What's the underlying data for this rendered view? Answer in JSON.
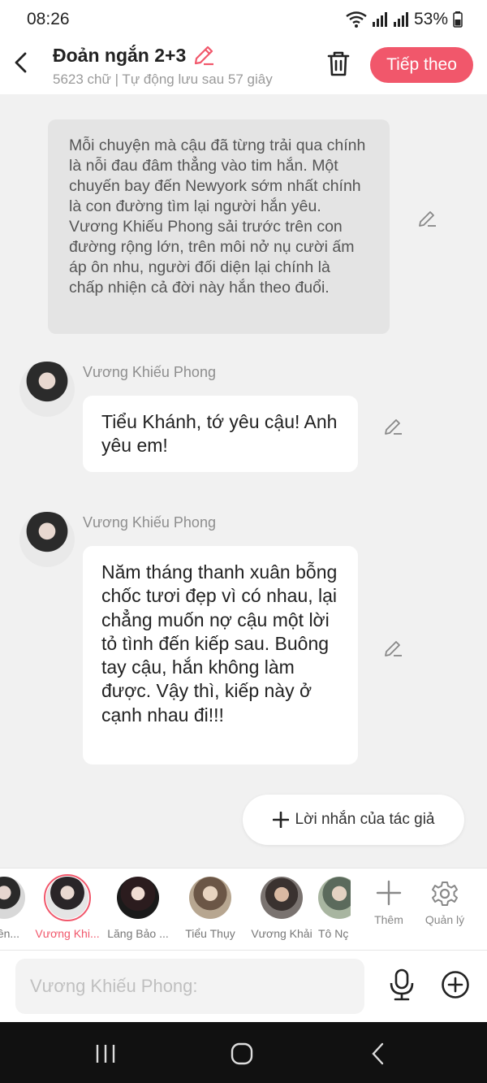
{
  "status": {
    "time": "08:26",
    "battery": "53%"
  },
  "header": {
    "title": "Đoản ngắn 2+3",
    "subtitle": "5623 chữ | Tự động lưu sau 57 giây",
    "next_label": "Tiếp theo"
  },
  "narration": "Mỗi chuyện mà cậu đã từng trải qua chính là nỗi đau đâm thẳng vào tim hắn. Một chuyến bay đến Newyork sớm nhất chính là con đường tìm lại người hắn yêu. Vương Khiếu Phong sải trước trên con đường rộng lớn, trên môi nở nụ cười ấm áp ôn nhu, người đối diện lại chính là chấp nhiện cả đời này hắn theo đuổi.",
  "messages": [
    {
      "name": "Vương Khiếu Phong",
      "text": "Tiểu Khánh, tớ yêu cậu! Anh yêu em!"
    },
    {
      "name": "Vương Khiếu Phong",
      "text": "Năm tháng thanh xuân bỗng chốc tươi đẹp vì có nhau, lại chẳng muốn nợ cậu một lời tỏ tình đến kiếp sau. Buông tay cậu, hắn không làm được. Vậy thì, kiếp này ở cạnh nhau đi!!!"
    }
  ],
  "author_note_label": "Lời nhắn của tác giả",
  "characters": [
    {
      "label": "hiên...",
      "color": "#bcbcbc"
    },
    {
      "label": "Vương Khi...",
      "color": "#2e2a2c"
    },
    {
      "label": "Lăng Bảo ...",
      "color": "#3a2a2c"
    },
    {
      "label": "Tiểu Thụy",
      "color": "#8a7360"
    },
    {
      "label": "Vương Khải",
      "color": "#4a4440"
    },
    {
      "label": "Tô Nç",
      "color": "#7a8a7a"
    }
  ],
  "tools": {
    "add_label": "Thêm",
    "manage_label": "Quản lý"
  },
  "input": {
    "placeholder": "Vương Khiếu Phong:"
  }
}
